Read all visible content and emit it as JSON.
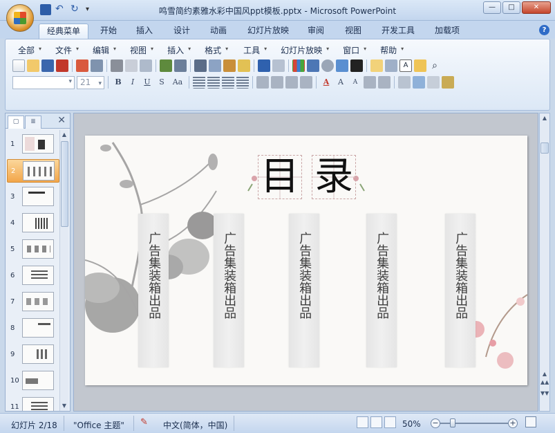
{
  "window": {
    "title": "鸣雪简约素雅水彩中国风ppt模板.pptx - Microsoft PowerPoint",
    "controls": {
      "minimize": "—",
      "maximize": "□",
      "close": "✕"
    }
  },
  "ribbon_tabs": [
    {
      "label": "经典菜单",
      "active": true
    },
    {
      "label": "开始"
    },
    {
      "label": "插入"
    },
    {
      "label": "设计"
    },
    {
      "label": "动画"
    },
    {
      "label": "幻灯片放映"
    },
    {
      "label": "审阅"
    },
    {
      "label": "视图"
    },
    {
      "label": "开发工具"
    },
    {
      "label": "加载项"
    }
  ],
  "classic_menu": [
    "全部",
    "文件",
    "编辑",
    "视图",
    "插入",
    "格式",
    "工具",
    "幻灯片放映",
    "窗口",
    "帮助"
  ],
  "font_box": {
    "name": "",
    "size": "21"
  },
  "format_buttons": {
    "bold": "B",
    "italic": "I",
    "underline": "U",
    "shadow": "S",
    "change_case": "Aa"
  },
  "slides_panel": {
    "thumbnails": [
      {
        "num": "1"
      },
      {
        "num": "2",
        "selected": true
      },
      {
        "num": "3"
      },
      {
        "num": "4"
      },
      {
        "num": "5"
      },
      {
        "num": "6"
      },
      {
        "num": "7"
      },
      {
        "num": "8"
      },
      {
        "num": "9"
      },
      {
        "num": "10"
      },
      {
        "num": "11"
      }
    ]
  },
  "slide": {
    "heading": [
      "目",
      "录"
    ],
    "columns": [
      "广告集装箱出品",
      "广告集装箱出品",
      "广告集装箱出品",
      "广告集装箱出品",
      "广告集装箱出品"
    ]
  },
  "status_bar": {
    "slide_info": "幻灯片 2/18",
    "theme": "\"Office 主题\"",
    "language": "中文(简体，中国)",
    "zoom": "50%"
  },
  "colors": {
    "accent": "#2e6bc7",
    "selected_thumb": "#f2a64a",
    "ribbon_bg": "#dce8f6"
  }
}
